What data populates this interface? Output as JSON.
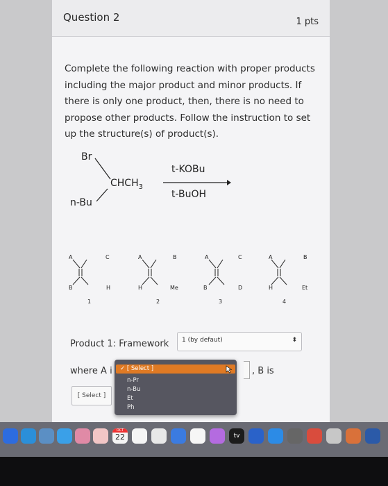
{
  "question": {
    "title": "Question 2",
    "points": "1 pts",
    "text": "Complete the following reaction with proper products including the major product and minor products. If there is only one product, then, there is no need to propose other products. Follow the instruction to set up the structure(s) of product(s)."
  },
  "reaction": {
    "br_label": "Br",
    "chch3_label": "CHCH",
    "chch3_sub": "3",
    "nbu_label": "n-Bu",
    "reagent": "t-KOBu",
    "solvent": "t-BuOH"
  },
  "frameworks": [
    {
      "number": "1",
      "labels": [
        "A",
        "C",
        "B",
        "H"
      ]
    },
    {
      "number": "2",
      "labels": [
        "A",
        "B",
        "H",
        "Me"
      ]
    },
    {
      "number": "3",
      "labels": [
        "A",
        "C",
        "B",
        "D"
      ]
    },
    {
      "number": "4",
      "labels": [
        "A",
        "B",
        "H",
        "Et"
      ]
    }
  ],
  "form": {
    "product_label": "Product 1: Framework",
    "framework_value": "1 (by defaut)",
    "where_label": "where A i",
    "b_label": ", B is",
    "select_placeholder": "[ Select ]"
  },
  "dropdown": {
    "selected": "✓ [ Select ]",
    "options": [
      "n-Pr",
      "n-Bu",
      "Et",
      "Ph"
    ]
  },
  "dock": {
    "calendar_month": "OCT",
    "calendar_day": "22",
    "tv_label": "tv"
  }
}
